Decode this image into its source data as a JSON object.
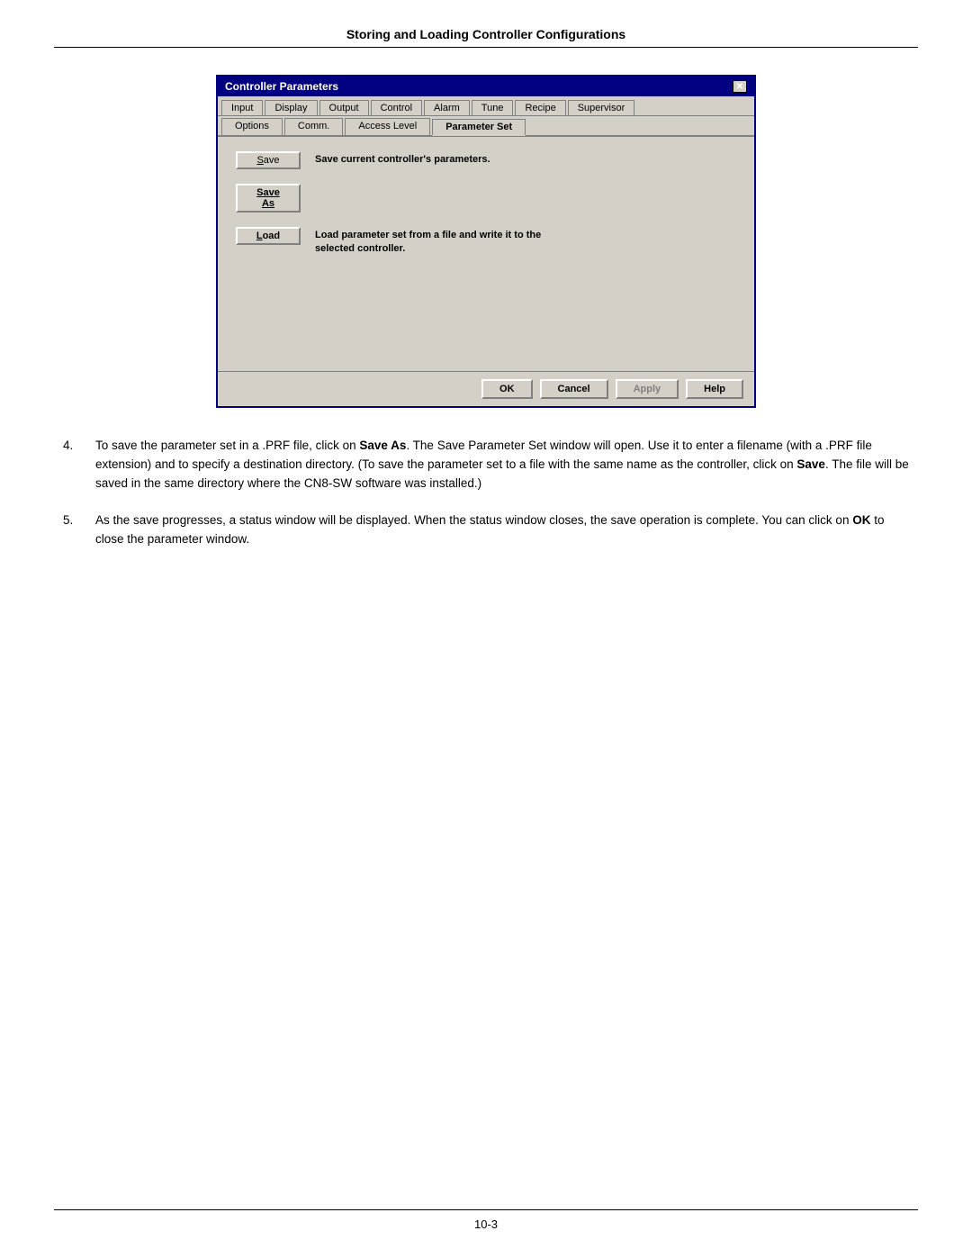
{
  "page": {
    "title": "Storing and Loading Controller Configurations",
    "footer": "10-3"
  },
  "dialog": {
    "title": "Controller Parameters",
    "close_label": "×",
    "tabs_row1": [
      {
        "label": "Input"
      },
      {
        "label": "Display"
      },
      {
        "label": "Output"
      },
      {
        "label": "Control"
      },
      {
        "label": "Alarm"
      },
      {
        "label": "Tune"
      },
      {
        "label": "Recipe"
      },
      {
        "label": "Supervisor"
      }
    ],
    "tabs_row2": [
      {
        "label": "Options"
      },
      {
        "label": "Comm."
      },
      {
        "label": "Access Level"
      },
      {
        "label": "Parameter Set",
        "active": true
      }
    ],
    "param_set_label": "Parameter Set",
    "buttons": [
      {
        "label": "Save",
        "description": "Save current controller's parameters.",
        "underline_char": "S"
      },
      {
        "label": "Save As",
        "description": "",
        "underline_char": "A"
      },
      {
        "label": "Load",
        "description": "Load parameter set from a file and write it to the selected controller.",
        "underline_char": "L"
      }
    ],
    "bottom_buttons": [
      {
        "label": "OK",
        "disabled": false
      },
      {
        "label": "Cancel",
        "disabled": false
      },
      {
        "label": "Apply",
        "disabled": true
      },
      {
        "label": "Help",
        "disabled": false
      }
    ]
  },
  "body_items": [
    {
      "number": "4.",
      "text": "To save the parameter set in a .PRF file, click on Save As.  The Save Parameter Set window will open.  Use it to enter a filename (with a .PRF file extension) and to specify a destination directory.  (To save the parameter set to a file with the same name as the controller, click on Save.  The file will be saved in the same directory where the CN8-SW software was installed.)"
    },
    {
      "number": "5.",
      "text": "As the save progresses, a status window will be displayed.  When the status window closes, the save operation is complete.  You can click on OK to close the parameter window."
    }
  ]
}
